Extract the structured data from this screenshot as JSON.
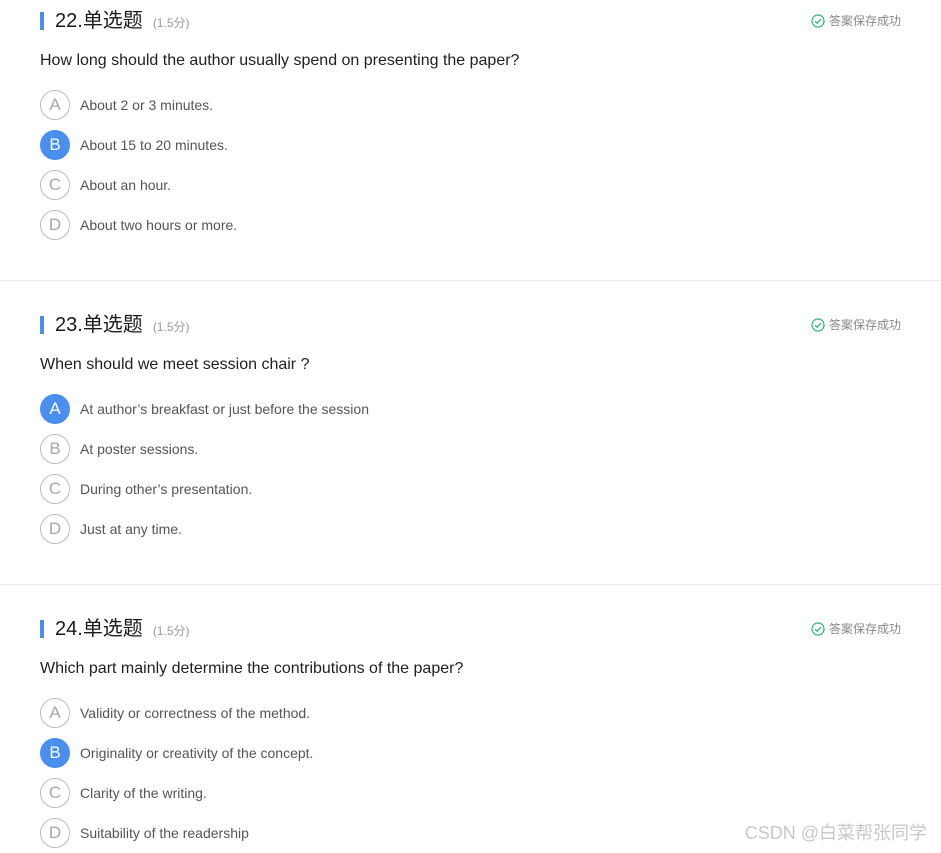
{
  "colors": {
    "accent": "#4a8ff0",
    "success": "#2bb574",
    "divider": "#ececec"
  },
  "questions": [
    {
      "number": "22.",
      "type": "单选题",
      "score": "(1.5分)",
      "status": "答案保存成功",
      "text": "How long should the author usually spend on presenting the paper?",
      "selected": "B",
      "options": [
        {
          "letter": "A",
          "text": "About 2 or 3 minutes."
        },
        {
          "letter": "B",
          "text": "About 15 to 20 minutes."
        },
        {
          "letter": "C",
          "text": "About an hour."
        },
        {
          "letter": "D",
          "text": "About two hours or more."
        }
      ]
    },
    {
      "number": "23.",
      "type": "单选题",
      "score": "(1.5分)",
      "status": "答案保存成功",
      "text": "When should we meet session chair ?",
      "selected": "A",
      "options": [
        {
          "letter": "A",
          "text": "At author’s breakfast or just before the session"
        },
        {
          "letter": "B",
          "text": "At poster sessions."
        },
        {
          "letter": "C",
          "text": "During other’s presentation."
        },
        {
          "letter": "D",
          "text": "Just at any time."
        }
      ]
    },
    {
      "number": "24.",
      "type": "单选题",
      "score": "(1.5分)",
      "status": "答案保存成功",
      "text": "Which part mainly determine the contributions of the paper?",
      "selected": "B",
      "options": [
        {
          "letter": "A",
          "text": "Validity or correctness of the method."
        },
        {
          "letter": "B",
          "text": "Originality or creativity of the concept."
        },
        {
          "letter": "C",
          "text": "Clarity of the writing."
        },
        {
          "letter": "D",
          "text": "Suitability of the readership"
        }
      ]
    }
  ],
  "watermark": "CSDN @白菜帮张同学"
}
